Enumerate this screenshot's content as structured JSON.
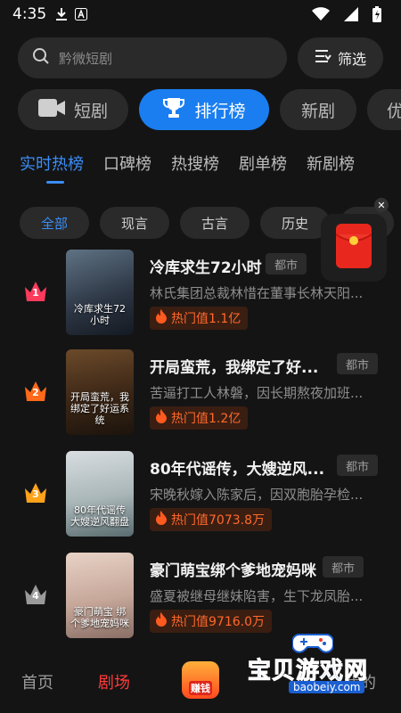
{
  "status": {
    "time": "4:35"
  },
  "search": {
    "placeholder": "黔微短剧",
    "filter_label": "筛选"
  },
  "category_tabs": [
    {
      "label": "短剧",
      "icon": "video-camera-icon"
    },
    {
      "label": "排行榜",
      "icon": "trophy-icon"
    },
    {
      "label": "新剧"
    },
    {
      "label": "优"
    }
  ],
  "rank_tabs": [
    "实时热榜",
    "口碑榜",
    "热搜榜",
    "剧单榜",
    "新剧榜"
  ],
  "filter_chips": [
    "全部",
    "现言",
    "古言",
    "历史"
  ],
  "dramas": [
    {
      "rank": "1",
      "title": "冷库求生72小时",
      "tag": "都市",
      "desc": "林氏集团总裁林惜在董事长林天阳...",
      "hot": "热门值1.1亿",
      "poster_text": "冷库求生72小时",
      "crown_color": "#ff3b5c"
    },
    {
      "rank": "2",
      "title": "开局蛮荒，我绑定了好...",
      "tag": "都市",
      "desc": "苦逼打工人林磐，因长期熬夜加班...",
      "hot": "热门值1.2亿",
      "poster_text": "开局蛮荒，我绑定了好运系统",
      "crown_color": "#ff6a1a"
    },
    {
      "rank": "3",
      "title": "80年代谣传，大嫂逆风...",
      "tag": "都市",
      "desc": "宋晚秋嫁入陈家后，因双胞胎孕检...",
      "hot": "热门值7073.8万",
      "poster_text": "80年代谣传 大嫂逆风翻盘",
      "crown_color": "#ffa31a"
    },
    {
      "rank": "4",
      "title": "豪门萌宝绑个爹地宠妈咪",
      "tag": "都市",
      "desc": "盛夏被继母继妹陷害，生下龙凤胎...",
      "hot": "热门值9716.0万",
      "poster_text": "豪门萌宝 绑个爹地宠妈咪",
      "crown_color": "#9a9a9a"
    }
  ],
  "bottom_nav": {
    "home": "首页",
    "theater": "剧场",
    "earn": "赚钱",
    "mine": "我的"
  },
  "watermark": {
    "title": "宝贝游戏网",
    "url": "baobeiy.com"
  },
  "colors": {
    "accent": "#1a7ef0",
    "active_nav": "#ff3b3b",
    "hot": "#ff6a2a"
  }
}
